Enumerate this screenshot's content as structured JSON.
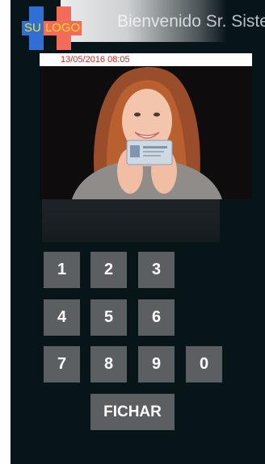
{
  "header": {
    "title": "Bienvenido Sr. Sistema de",
    "logo": {
      "left": "SU",
      "right": "LOGO"
    }
  },
  "camera": {
    "timestamp": "13/05/2016  08:05"
  },
  "keypad": {
    "keys": [
      "1",
      "2",
      "3",
      "4",
      "5",
      "6",
      "7",
      "8",
      "9",
      "0"
    ],
    "action_label": "FICHAR"
  },
  "colors": {
    "background": "#071418",
    "key": "#5c5f61",
    "timestamp": "#d42424",
    "logo_blue": "#2f6fd6",
    "logo_red": "#f26b5b",
    "logo_text": "#f6e11b"
  }
}
